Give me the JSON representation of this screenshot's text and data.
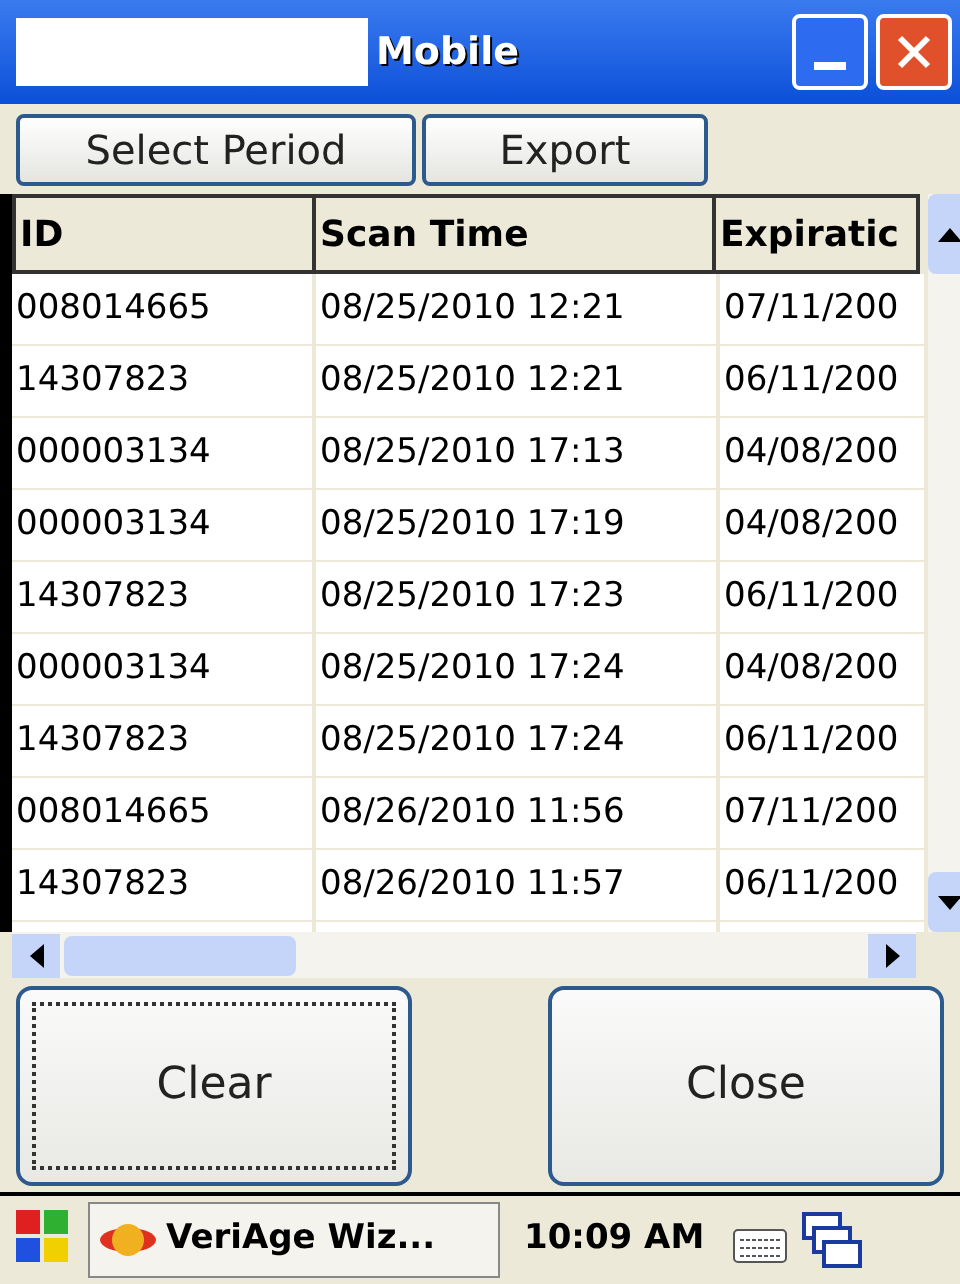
{
  "window": {
    "title": "Mobile"
  },
  "toolbar": [
    "Select Period",
    "Export"
  ],
  "table": {
    "columns": [
      "ID",
      "Scan Time",
      "Expiratic"
    ],
    "rows": [
      [
        "008014665",
        "08/25/2010 12:21",
        "07/11/200"
      ],
      [
        "14307823",
        "08/25/2010 12:21",
        "06/11/200"
      ],
      [
        "000003134",
        "08/25/2010 17:13",
        "04/08/200"
      ],
      [
        "000003134",
        "08/25/2010 17:19",
        "04/08/200"
      ],
      [
        "14307823",
        "08/25/2010 17:23",
        "06/11/200"
      ],
      [
        "000003134",
        "08/25/2010 17:24",
        "04/08/200"
      ],
      [
        "14307823",
        "08/25/2010 17:24",
        "06/11/200"
      ],
      [
        "008014665",
        "08/26/2010 11:56",
        "07/11/200"
      ],
      [
        "14307823",
        "08/26/2010 11:57",
        "06/11/200"
      ]
    ]
  },
  "buttons": [
    {
      "label": "Clear",
      "focused": true
    },
    {
      "label": "Close",
      "focused": false
    }
  ],
  "taskbar": {
    "app": "VeriAge Wiz...",
    "time": "10:09 AM"
  }
}
